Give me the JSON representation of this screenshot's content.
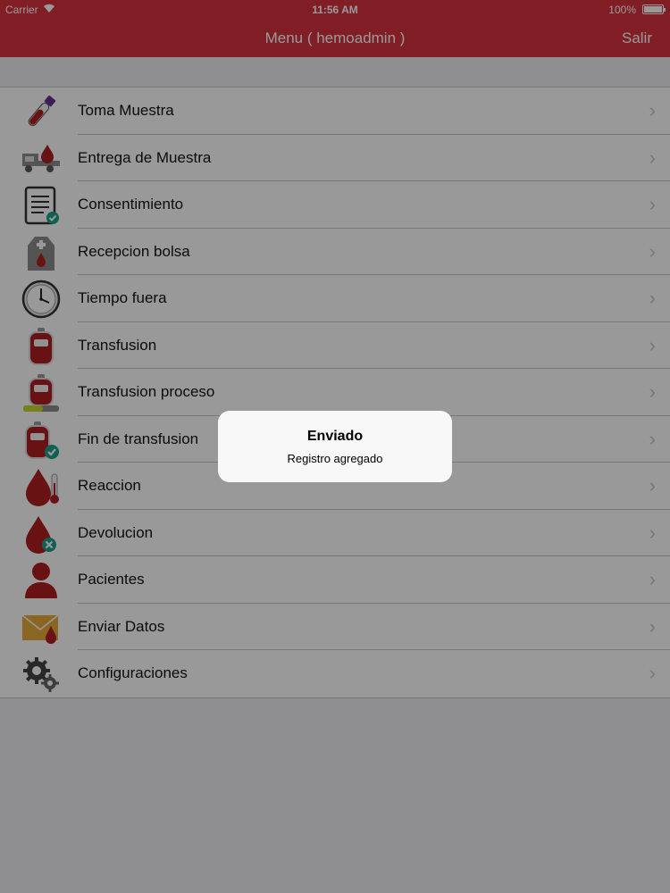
{
  "status_bar": {
    "carrier": "Carrier",
    "time": "11:56 AM",
    "battery": "100%"
  },
  "nav": {
    "title": "Menu ( hemoadmin )",
    "logout_label": "Salir",
    "color": "#d8323f"
  },
  "menu": [
    {
      "label": "Toma Muestra",
      "icon": "blood-sample-tube-icon"
    },
    {
      "label": "Entrega de Muestra",
      "icon": "delivery-truck-blood-icon"
    },
    {
      "label": "Consentimiento",
      "icon": "consent-document-icon"
    },
    {
      "label": "Recepcion bolsa",
      "icon": "blood-bag-reception-icon"
    },
    {
      "label": "Tiempo fuera",
      "icon": "clock-icon"
    },
    {
      "label": "Transfusion",
      "icon": "blood-bag-icon"
    },
    {
      "label": "Transfusion proceso",
      "icon": "blood-bag-progress-icon"
    },
    {
      "label": "Fin de transfusion",
      "icon": "blood-bag-check-icon"
    },
    {
      "label": "Reaccion",
      "icon": "blood-drop-thermometer-icon"
    },
    {
      "label": "Devolucion",
      "icon": "blood-drop-cancel-icon"
    },
    {
      "label": "Pacientes",
      "icon": "patient-icon"
    },
    {
      "label": "Enviar Datos",
      "icon": "envelope-blood-icon"
    },
    {
      "label": "Configuraciones",
      "icon": "gears-icon"
    }
  ],
  "alert": {
    "title": "Enviado",
    "message": "Registro agregado"
  },
  "colors": {
    "brand_red": "#d8323f",
    "blood": "#b01e22",
    "accent_teal": "#1a9e8a"
  }
}
